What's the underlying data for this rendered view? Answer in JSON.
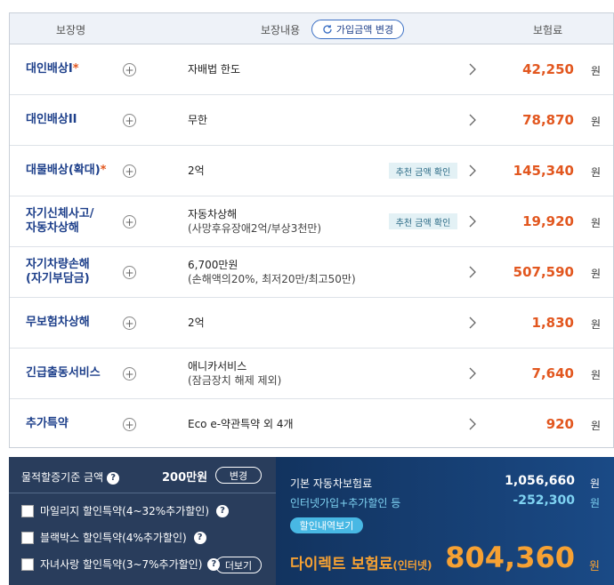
{
  "header": {
    "col_name": "보장명",
    "col_content": "보장내용",
    "col_premium": "보험료",
    "change_amount_button": "가입금액 변경"
  },
  "coverages": [
    {
      "name": "대인배상I",
      "required": "*",
      "detail": "자배법 한도",
      "detail_sub": "",
      "recommend": "",
      "premium": "42,250",
      "unit": "원"
    },
    {
      "name": "대인배상II",
      "required": "",
      "detail": "무한",
      "detail_sub": "",
      "recommend": "",
      "premium": "78,870",
      "unit": "원"
    },
    {
      "name": "대물배상(확대)",
      "required": "*",
      "detail": "2억",
      "detail_sub": "",
      "recommend": "추천 금액 확인",
      "premium": "145,340",
      "unit": "원"
    },
    {
      "name": "자기신체사고/",
      "name2": "자동차상해",
      "required": "",
      "detail": "자동차상해",
      "detail_sub": "(사망후유장애2억/부상3천만)",
      "recommend": "추천 금액 확인",
      "premium": "19,920",
      "unit": "원"
    },
    {
      "name": "자기차량손해",
      "name2": "(자기부담금)",
      "required": "",
      "detail": "6,700만원",
      "detail_sub": "(손해액의20%, 최저20만/최고50만)",
      "recommend": "",
      "premium": "507,590",
      "unit": "원"
    },
    {
      "name": "무보험차상해",
      "required": "",
      "detail": "2억",
      "detail_sub": "",
      "recommend": "",
      "premium": "1,830",
      "unit": "원"
    },
    {
      "name": "긴급출동서비스",
      "required": "",
      "detail": "애니카서비스",
      "detail_sub": "(잠금장치 해제 제외)",
      "recommend": "",
      "premium": "7,640",
      "unit": "원"
    },
    {
      "name": "추가특약",
      "required": "",
      "detail": "Eco e-약관특약 외 4개",
      "detail_sub": "",
      "recommend": "",
      "premium": "920",
      "unit": "원"
    }
  ],
  "options": {
    "property_label": "물적할증기준 금액",
    "property_amount": "200만원",
    "change_button": "변경",
    "mileage": "마일리지 할인특약(4~32%추가할인)",
    "blackbox": "블랙박스 할인특약(4%추가할인)",
    "child": "자녀사랑 할인특약(3~7%추가할인)",
    "more_button": "더보기",
    "help_glyph": "?"
  },
  "summary": {
    "base_label": "기본 자동차보험료",
    "base_value": "1,056,660",
    "discount_label": "인터넷가입+추가할인 등",
    "discount_value": "-252,300",
    "discount_button": "할인내역보기",
    "direct_label": "다이렉트 보험료",
    "direct_label_sub": "(인터넷)",
    "direct_value": "804,360",
    "unit": "원"
  },
  "colors": {
    "accent_orange": "#e2571f",
    "navy": "#1d3f8a",
    "panel_left": "#293d5c",
    "panel_right": "#12335f",
    "highlight": "#f6a133"
  }
}
